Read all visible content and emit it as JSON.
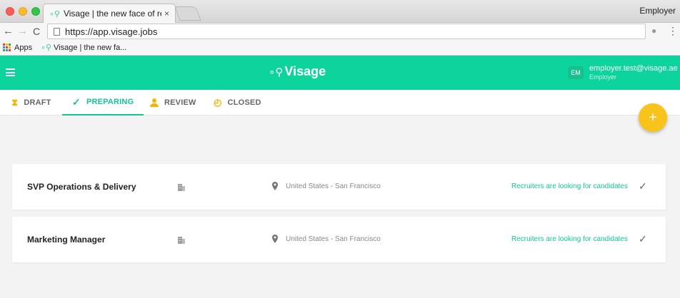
{
  "browser": {
    "tab_title": "Visage | the new face of recrui",
    "tab_close": "×",
    "profile": "Employer",
    "url": "https://app.visage.jobs",
    "bookmarks": [
      {
        "label": "Apps"
      },
      {
        "label": "Visage | the new fa..."
      }
    ]
  },
  "header": {
    "brand": "Visage",
    "user_initials": "EM",
    "user_email": "employer.test@visage.ae",
    "user_role": "Employer",
    "accent_color": "#0cd49c"
  },
  "tabs": [
    {
      "label": "DRAFT",
      "icon": "hourglass-icon"
    },
    {
      "label": "PREPARING",
      "icon": "check-icon",
      "active": true
    },
    {
      "label": "REVIEW",
      "icon": "person-icon"
    },
    {
      "label": "CLOSED",
      "icon": "history-icon"
    }
  ],
  "fab": {
    "label": "+",
    "color": "#f8c31a"
  },
  "jobs": [
    {
      "title": "SVP Operations & Delivery",
      "location": "United States - San Francisco",
      "status": "Recruiters are looking for candidates"
    },
    {
      "title": "Marketing Manager",
      "location": "United States - San Francisco",
      "status": "Recruiters are looking for candidates"
    }
  ]
}
